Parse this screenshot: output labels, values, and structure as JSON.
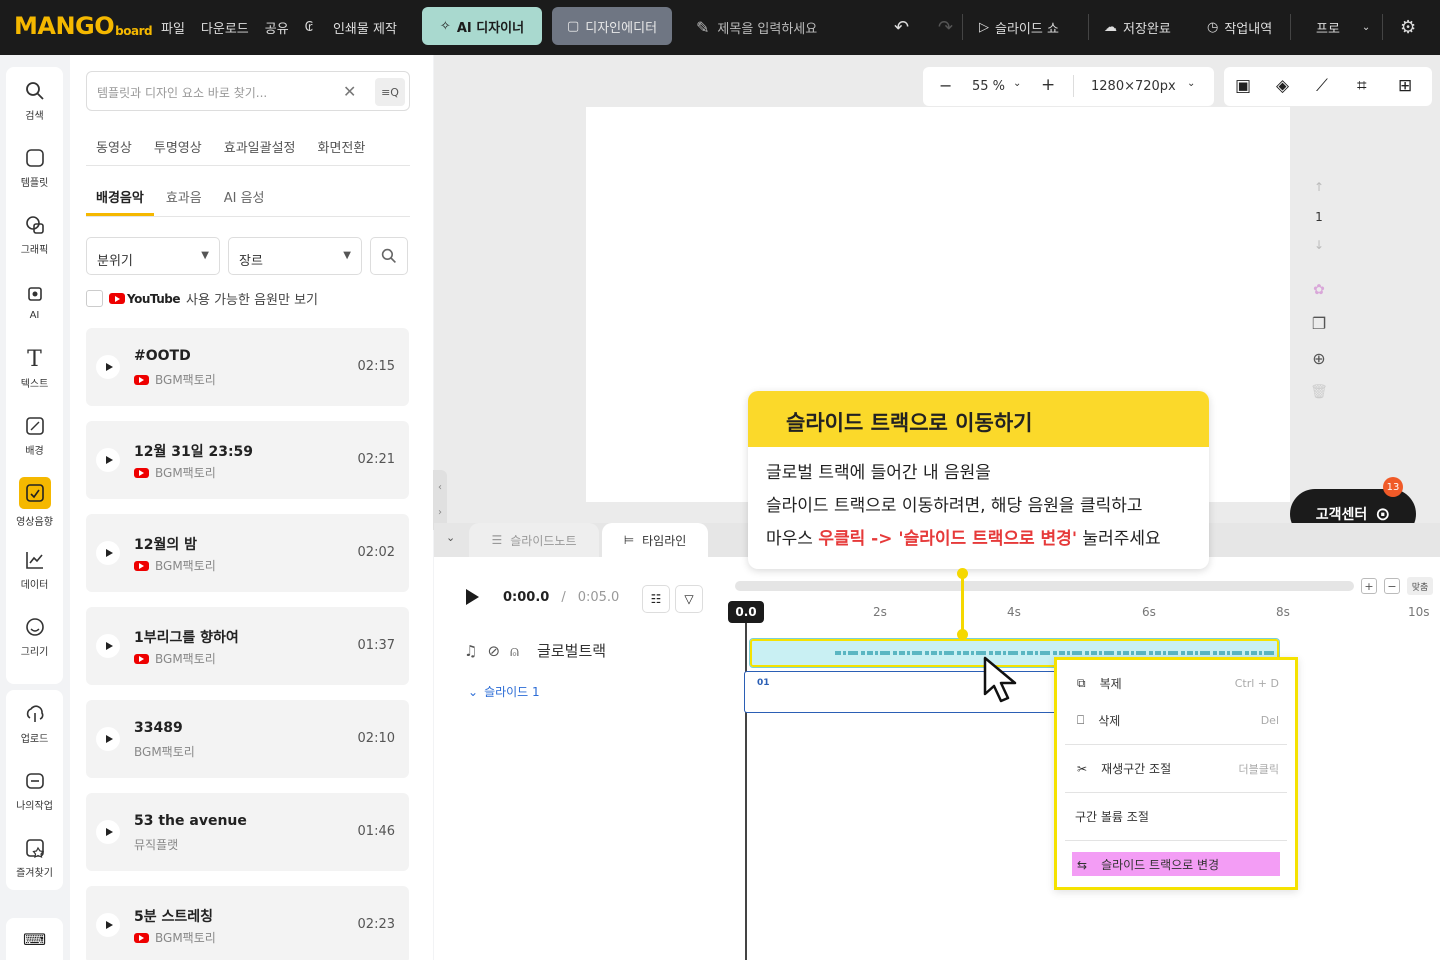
{
  "brand": {
    "logo_main": "MANGO",
    "logo_sub": "board"
  },
  "topbar": {
    "menu": [
      "파일",
      "다운로드",
      "공유",
      "인쇄물 제작"
    ],
    "ai_designer": "AI 디자이너",
    "design_editor": "디자인에디터",
    "title_placeholder": "제목을 입력하세요",
    "slideshow": "슬라이드 쇼",
    "save_status": "저장완료",
    "history": "작업내역",
    "plan": "프로"
  },
  "nav": [
    {
      "label": "검색",
      "icon": "search-icon"
    },
    {
      "label": "템플릿",
      "icon": "template-icon"
    },
    {
      "label": "그래픽",
      "icon": "graphic-icon"
    },
    {
      "label": "AI",
      "icon": "ai-chip-icon"
    },
    {
      "label": "텍스트",
      "icon": "text-icon"
    },
    {
      "label": "배경",
      "icon": "background-icon"
    },
    {
      "label": "영상음향",
      "icon": "media-icon"
    },
    {
      "label": "데이터",
      "icon": "chart-icon"
    },
    {
      "label": "그리기",
      "icon": "draw-icon"
    },
    {
      "label": "업로드",
      "icon": "upload-icon"
    },
    {
      "label": "나의작업",
      "icon": "my-work-icon"
    },
    {
      "label": "즐겨찾기",
      "icon": "favorite-icon"
    }
  ],
  "panel": {
    "search_placeholder": "템플릿과 디자인 요소 바로 찾기...",
    "tabs1": [
      "동영상",
      "투명영상",
      "효과일괄설정",
      "화면전환"
    ],
    "tabs2": [
      "배경음악",
      "효과음",
      "AI 음성"
    ],
    "filter_mood": "분위기",
    "filter_genre": "장르",
    "youtube_label": "YouTube",
    "youtube_only": "사용 가능한 음원만 보기",
    "tracks": [
      {
        "title": "#OOTD",
        "source": "BGM팩토리",
        "duration": "02:15"
      },
      {
        "title": "12월 31일 23:59",
        "source": "BGM팩토리",
        "duration": "02:21"
      },
      {
        "title": "12월의 밤",
        "source": "BGM팩토리",
        "duration": "02:02"
      },
      {
        "title": "1부리그를 향하여",
        "source": "BGM팩토리",
        "duration": "01:37"
      },
      {
        "title": "33489",
        "source": "BGM팩토리",
        "duration": "02:10"
      },
      {
        "title": "53 the avenue",
        "source": "뮤직플랫",
        "duration": "01:46"
      },
      {
        "title": "5분 스트레칭",
        "source": "BGM팩토리",
        "duration": "02:23"
      }
    ]
  },
  "canvas": {
    "zoom": "55 %",
    "size": "1280×720px",
    "page_num": "1"
  },
  "help": {
    "label": "고객센터",
    "badge": "13"
  },
  "timeline": {
    "tab_notes": "슬라이드노트",
    "tab_timeline": "타임라인",
    "current": "0:00.0",
    "total": "0:05.0",
    "head": "0.0",
    "ticks": [
      "2s",
      "4s",
      "6s",
      "8s",
      "10s"
    ],
    "fit": "맞춤",
    "global_track": "글로벌트랙",
    "slide_label": "슬라이드 1",
    "slide_num": "01"
  },
  "callout": {
    "title": "슬라이드 트랙으로 이동하기",
    "line1": "글로벌 트랙에 들어간 내 음원을",
    "line2": "슬라이드 트랙으로 이동하려면, 해당 음원을 클릭하고",
    "line3_a": "마우스 ",
    "line3_b": "우클릭 -> '슬라이드 트랙으로 변경'",
    "line3_c": " 눌러주세요"
  },
  "context_menu": [
    {
      "label": "복제",
      "shortcut": "Ctrl + D",
      "icon": "copy-icon"
    },
    {
      "label": "삭제",
      "shortcut": "Del",
      "icon": "trash-icon"
    },
    {
      "label": "재생구간 조절",
      "shortcut": "더블클릭",
      "icon": "scissors-icon"
    },
    {
      "label": "구간 볼륨 조절",
      "shortcut": "",
      "icon": ""
    },
    {
      "label": "슬라이드 트랙으로 변경",
      "shortcut": "",
      "icon": "move-track-icon"
    }
  ],
  "colors": {
    "accent": "#f5b800",
    "highlight": "#f39df5",
    "callout_header": "#fbd92a",
    "alert_red": "#e63a3a"
  }
}
